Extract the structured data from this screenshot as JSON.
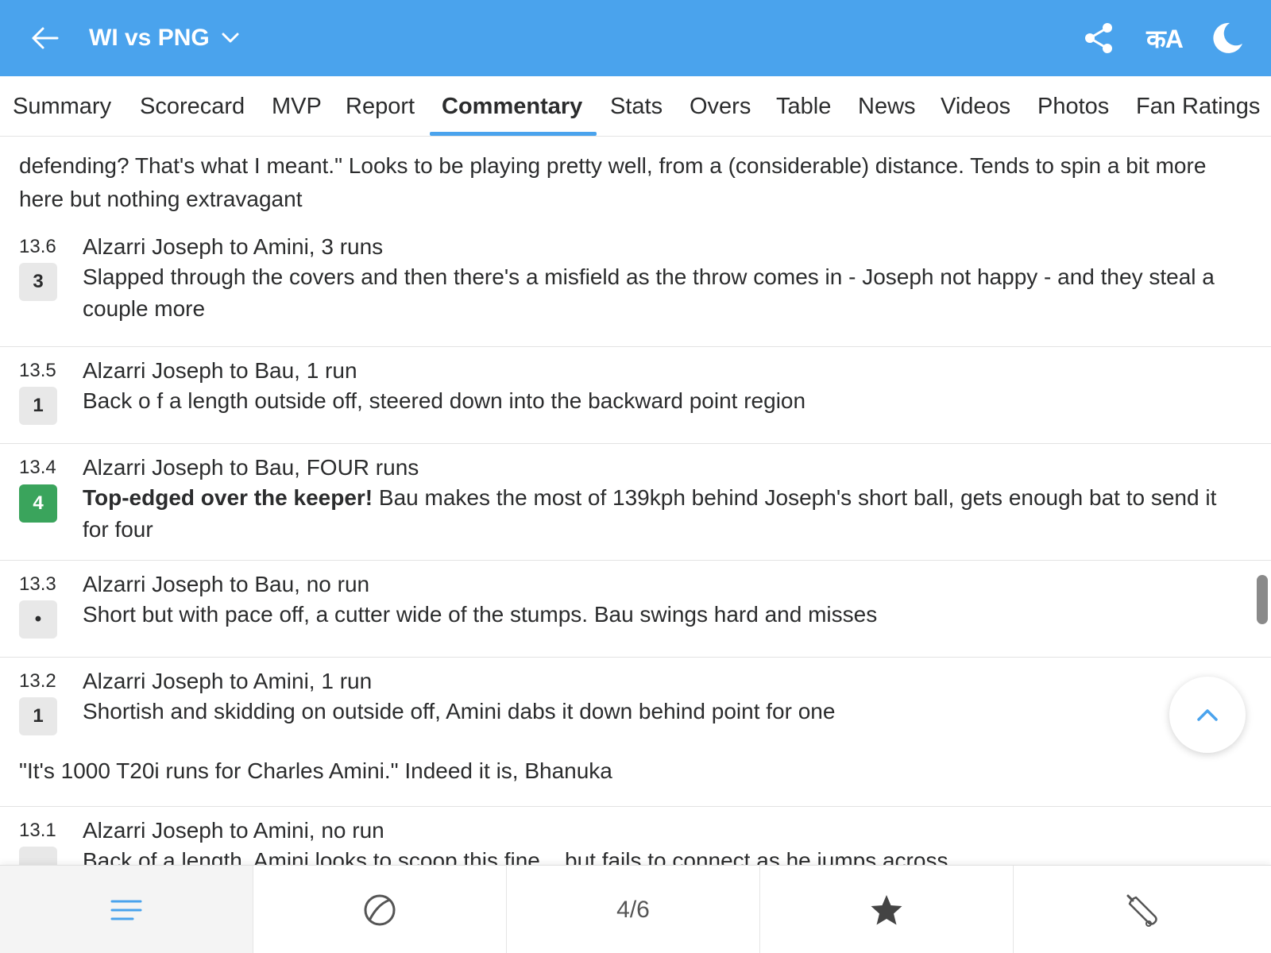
{
  "header": {
    "title": "WI vs PNG",
    "back_icon": "arrow-left-icon",
    "dropdown_icon": "chevron-down-icon",
    "share_icon": "share-icon",
    "language_label": "कA",
    "theme_icon": "moon-icon",
    "background_color": "#4aa3ed"
  },
  "tabs": [
    {
      "label": "Summary"
    },
    {
      "label": "Scorecard"
    },
    {
      "label": "MVP"
    },
    {
      "label": "Report"
    },
    {
      "label": "Commentary",
      "active": true
    },
    {
      "label": "Stats"
    },
    {
      "label": "Overs"
    },
    {
      "label": "Table"
    },
    {
      "label": "News"
    },
    {
      "label": "Videos"
    },
    {
      "label": "Photos"
    },
    {
      "label": "Fan Ratings"
    }
  ],
  "commentary": {
    "intro_text": "defending? That's what I meant.\" Looks to be playing pretty well, from a (considerable) distance. Tends to spin a bit more here but nothing extravagant",
    "balls": [
      {
        "over": "13.6",
        "runs": "3",
        "headline": "Alzarri Joseph to Amini, 3 runs",
        "text": "Slapped through the covers and then there's a misfield as the throw comes in - Joseph not happy - and they steal a couple more"
      },
      {
        "over": "13.5",
        "runs": "1",
        "headline": "Alzarri Joseph to Bau, 1 run",
        "text": "Back o f a length outside off, steered down into the backward point region"
      },
      {
        "over": "13.4",
        "runs": "4",
        "headline": "Alzarri Joseph to Bau, FOUR runs",
        "text_bold": "Top-edged over the keeper!",
        "text": " Bau makes the most of 139kph behind Joseph's short ball, gets enough bat to send it for four"
      },
      {
        "over": "13.3",
        "runs": "•",
        "headline": "Alzarri Joseph to Bau, no run",
        "text": "Short but with pace off, a cutter wide of the stumps. Bau swings hard and misses"
      },
      {
        "over": "13.2",
        "runs": "1",
        "headline": "Alzarri Joseph to Amini, 1 run",
        "text": "Shortish and skidding on outside off, Amini dabs it down behind point for one"
      },
      {
        "over": "13.1",
        "runs": "",
        "headline": "Alzarri Joseph to Amini, no run",
        "text": "Back of a length. Amini looks to scoop this fine... but fails to connect as he jumps across"
      }
    ],
    "note_text": "\"It's 1000 T20i runs for Charles Amini.\" Indeed it is, Bhanuka",
    "four_color": "#3aa45c"
  },
  "scroll_top_icon": "chevron-up-icon",
  "bottom_nav": {
    "items": [
      {
        "icon": "menu-lines-icon"
      },
      {
        "icon": "ball-icon"
      },
      {
        "label": "4/6"
      },
      {
        "icon": "star-icon"
      },
      {
        "icon": "cricket-bat-icon"
      }
    ]
  }
}
